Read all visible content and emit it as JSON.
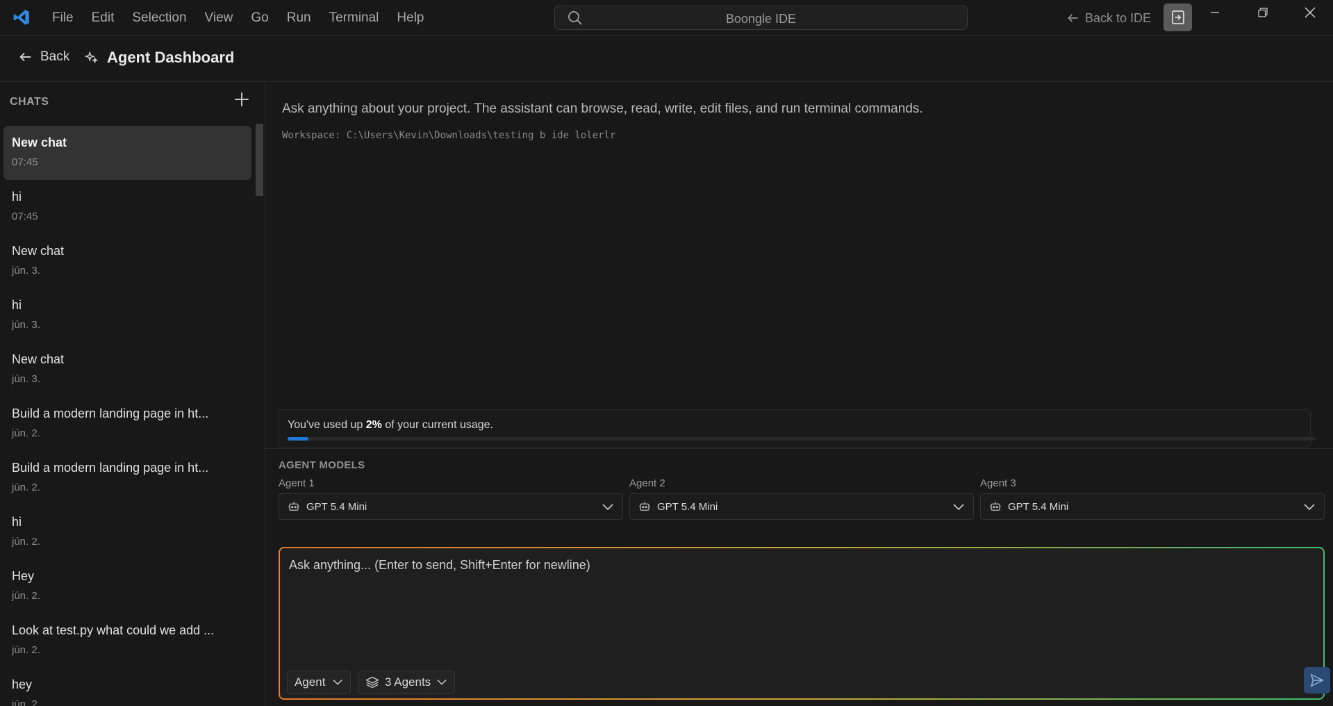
{
  "titlebar": {
    "menu": [
      "File",
      "Edit",
      "Selection",
      "View",
      "Go",
      "Run",
      "Terminal",
      "Help"
    ],
    "search_text": "Boongle IDE",
    "back_to_ide": "Back to IDE",
    "accent": "#2f8ae0"
  },
  "subheader": {
    "back_label": "Back",
    "title": "Agent Dashboard"
  },
  "sidebar": {
    "heading": "CHATS",
    "chats": [
      {
        "title": "New chat",
        "date": "07:45",
        "active": true
      },
      {
        "title": "hi",
        "date": "07:45"
      },
      {
        "title": "New chat",
        "date": "jún. 3."
      },
      {
        "title": "hi",
        "date": "jún. 3."
      },
      {
        "title": "New chat",
        "date": "jún. 3."
      },
      {
        "title": "Build a modern landing page in ht...",
        "date": "jún. 2."
      },
      {
        "title": "Build a modern landing page in ht...",
        "date": "jún. 2."
      },
      {
        "title": "hi",
        "date": "jún. 2."
      },
      {
        "title": "Hey",
        "date": "jún. 2."
      },
      {
        "title": "Look at test.py what could we add ...",
        "date": "jún. 2."
      },
      {
        "title": "hey",
        "date": "jún. 2."
      }
    ]
  },
  "main": {
    "intro": "Ask anything about your project. The assistant can browse, read, write, edit files, and run terminal commands.",
    "workspace": "Workspace: C:\\Users\\Kevin\\Downloads\\testing b ide lolerlr"
  },
  "usage": {
    "prefix": "You've used up ",
    "percent_text": "2%",
    "suffix": " of your current usage.",
    "fraction": 0.02,
    "color": "#1e7ad6"
  },
  "agent_models": {
    "heading": "AGENT MODELS",
    "agents": [
      {
        "label": "Agent 1",
        "model": "GPT 5.4 Mini"
      },
      {
        "label": "Agent 2",
        "model": "GPT 5.4 Mini"
      },
      {
        "label": "Agent 3",
        "model": "GPT 5.4 Mini"
      }
    ]
  },
  "composer": {
    "placeholder": "Ask anything... (Enter to send, Shift+Enter for newline)",
    "mode": "Agent",
    "agents_count": "3 Agents",
    "gradient": [
      "#e87a2a",
      "#3fbf6a"
    ]
  }
}
